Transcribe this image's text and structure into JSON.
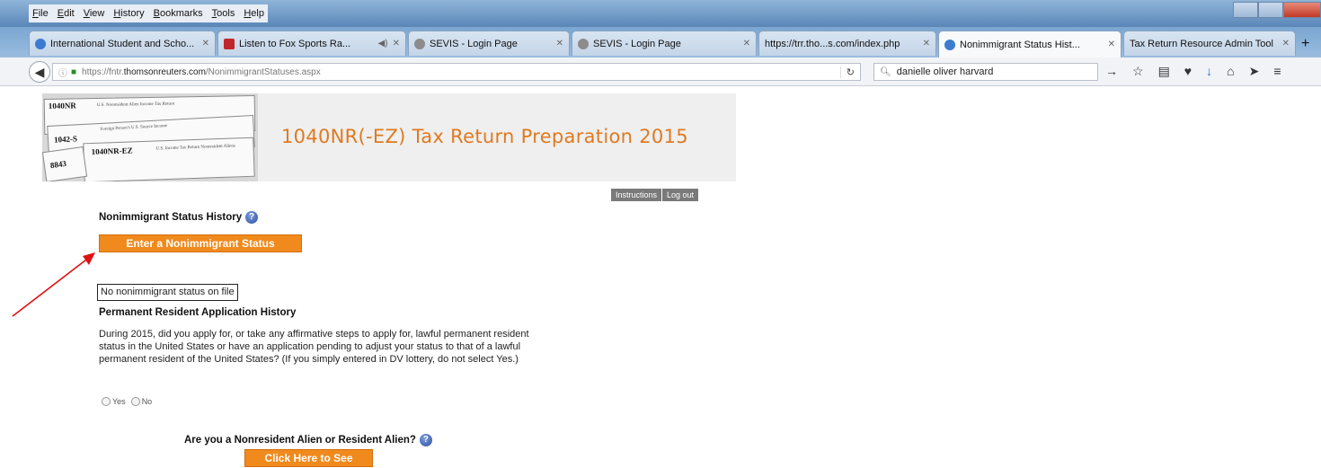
{
  "browser": {
    "menu": [
      "File",
      "Edit",
      "View",
      "History",
      "Bookmarks",
      "Tools",
      "Help"
    ],
    "tabs": [
      {
        "label": "International Student and Scho...",
        "icon_color": "#3b7bd0"
      },
      {
        "label": "Listen to Fox Sports Ra...",
        "icon_color": "#c0272d"
      },
      {
        "label": "SEVIS - Login Page",
        "icon_color": "#8c8c8c"
      },
      {
        "label": "SEVIS - Login Page",
        "icon_color": "#8c8c8c"
      },
      {
        "label": "https://trr.tho...s.com/index.php",
        "icon_color": "#bcbcbc"
      },
      {
        "label": "Nonimmigrant Status Hist...",
        "icon_color": "#3b7bd0",
        "active": true
      },
      {
        "label": "Tax Return Resource Admin Tool",
        "icon_color": "#bcbcbc"
      }
    ],
    "url_prefix": "https://fntr.",
    "url_domain": "thomsonreuters.com",
    "url_path": "/NonimmigrantStatuses.aspx",
    "search_value": "danielle oliver harvard",
    "toolbar_icons": [
      "forward-arrow-icon",
      "star-icon",
      "reading-list-icon",
      "pocket-icon",
      "download-icon",
      "home-icon",
      "send-icon",
      "menu-icon"
    ]
  },
  "banner": {
    "title": "1040NR(-EZ) Tax Return Preparation 2015",
    "form_labels": {
      "f1": "1040NR",
      "f1_sub": "U.S. Nonresident Alien Income Tax Return",
      "f2": "1042-S",
      "f2_sub": "Foreign Person's U.S. Source Income",
      "f3": "1040NR-EZ",
      "f3_sub": "U.S. Income Tax Return Nonresident Aliens",
      "f4": "8843"
    }
  },
  "links": {
    "instructions": "Instructions",
    "logout": "Log out"
  },
  "status_section": {
    "heading": "Nonimmigrant Status History",
    "enter_button": "Enter a Nonimmigrant Status",
    "empty_message": "No nonimmigrant status on file"
  },
  "permanent_section": {
    "heading": "Permanent Resident Application History",
    "question": "During 2015, did you apply for, or take any affirmative steps to apply for, lawful permanent resident status in the United States or have an application pending to adjust your status to that of a lawful permanent resident of the United States? (If you simply entered in DV lottery, do not select Yes.)",
    "yes_label": "Yes",
    "no_label": "No"
  },
  "alien_section": {
    "heading": "Are you a Nonresident Alien or Resident Alien?",
    "button": "Click Here to See"
  },
  "colors": {
    "accent_orange": "#f08a1d",
    "banner_title": "#e07a1f",
    "annotation_arrow": "#e01010"
  }
}
